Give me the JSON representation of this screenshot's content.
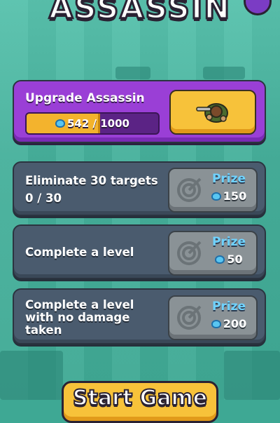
{
  "header": {
    "title": "ASSASSIN"
  },
  "upgrade": {
    "title": "Upgrade Assassin",
    "progress_text": "542 / 1000",
    "progress_value": 542,
    "progress_max": 1000,
    "button_icon": "assassin-character-icon"
  },
  "missions": [
    {
      "text": "Eliminate 30 targets",
      "progress": "0 / 30",
      "prize_label": "Prize",
      "prize_amount": "150",
      "icon": "target-icon"
    },
    {
      "text": "Complete a level",
      "prize_label": "Prize",
      "prize_amount": "50",
      "icon": "target-icon"
    },
    {
      "text_line1": "Complete a level",
      "text_line2": "with no damage",
      "text_line3": "taken",
      "prize_label": "Prize",
      "prize_amount": "200",
      "icon": "target-icon"
    }
  ],
  "start_button": {
    "label": "Start Game"
  },
  "colors": {
    "background": "#48b39e",
    "upgrade_card": "#9a3fd6",
    "mission_card": "#4a5b6e",
    "gold": "#f7c23a",
    "prize_text": "#6fd3ff"
  }
}
